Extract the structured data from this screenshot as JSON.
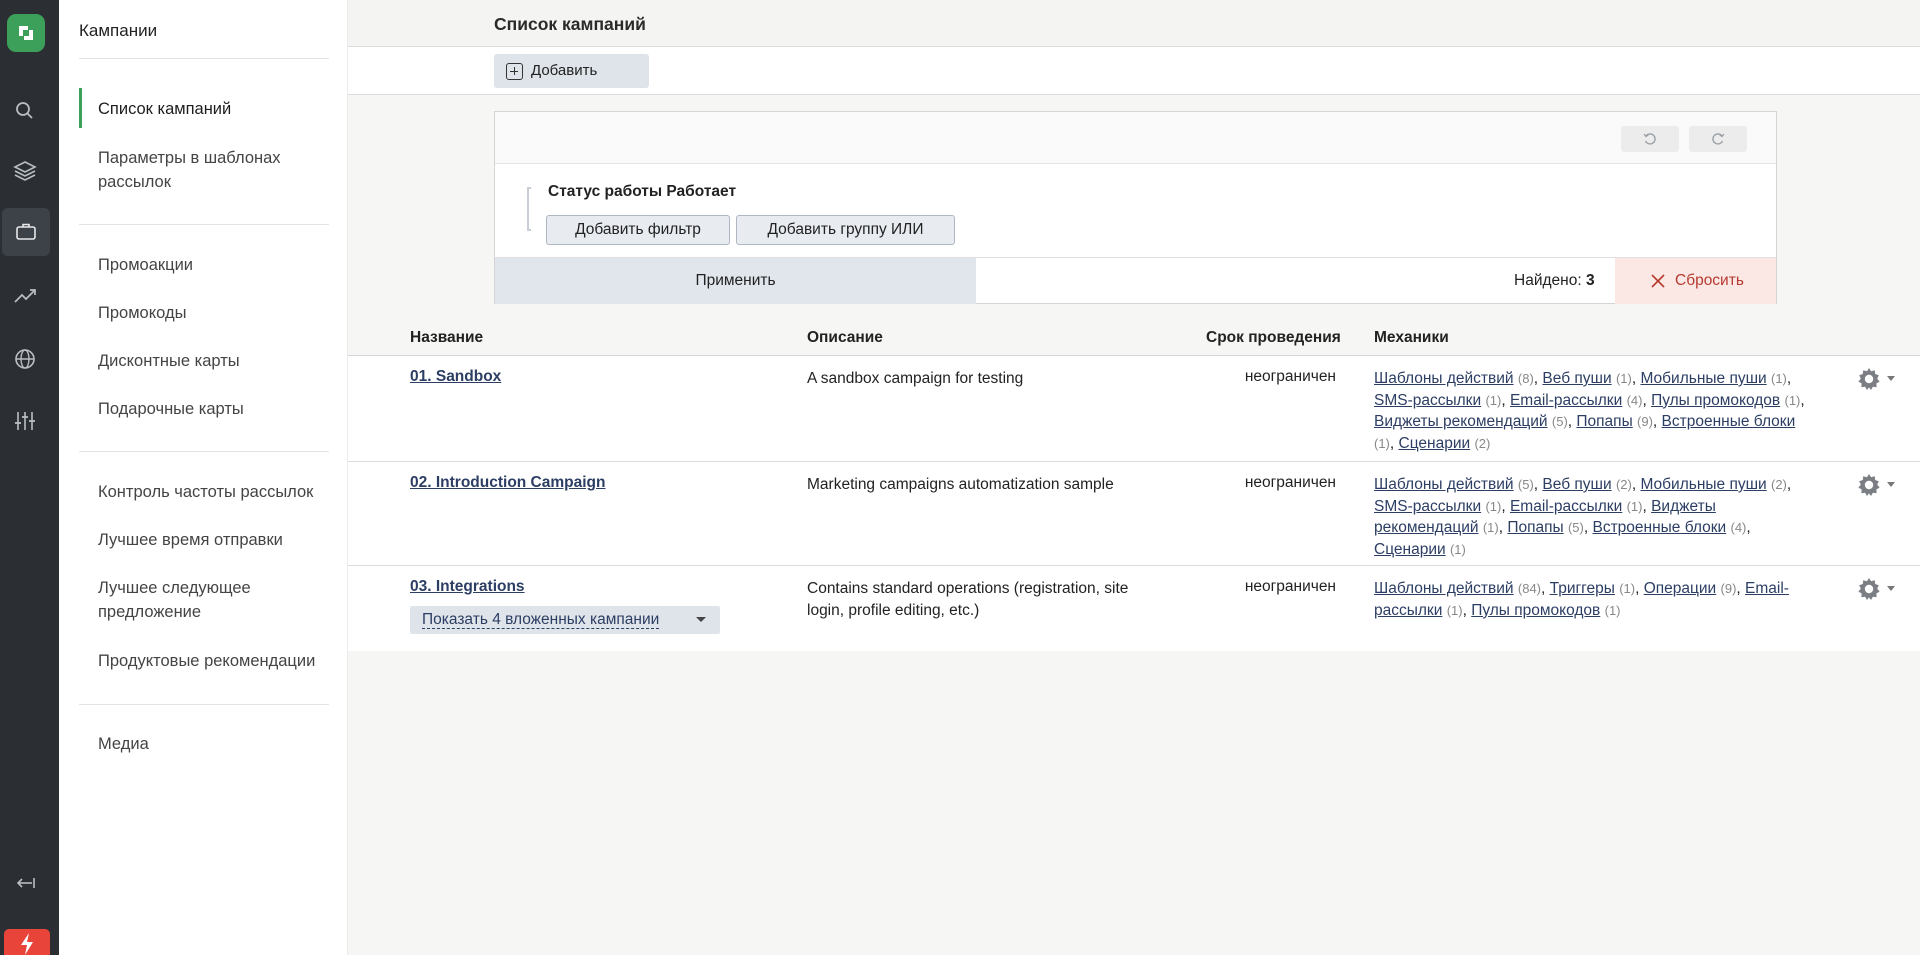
{
  "rail": {
    "icons": [
      "logo-icon",
      "search-icon",
      "layers-icon",
      "briefcase-icon",
      "trend-icon",
      "globe-icon",
      "sliders-icon",
      "collapse-icon",
      "bolt-icon"
    ],
    "accent": "#3da05a"
  },
  "sidebar": {
    "section_title": "Кампании",
    "items": [
      {
        "label": "Список кампаний"
      },
      {
        "label": "Параметры в шаблонах рассылок"
      },
      {
        "label": "Промоакции"
      },
      {
        "label": "Промокоды"
      },
      {
        "label": "Дисконтные карты"
      },
      {
        "label": "Подарочные карты"
      },
      {
        "label": "Контроль частоты рассылок"
      },
      {
        "label": "Лучшее время отправки"
      },
      {
        "label": "Лучшее следующее предложение"
      },
      {
        "label": "Продуктовые рекомендации"
      },
      {
        "label": "Медиа"
      }
    ]
  },
  "header": {
    "title": "Список кампаний",
    "add_label": "Добавить"
  },
  "filter": {
    "status_text": "Статус работы Работает",
    "add_filter_label": "Добавить фильтр",
    "add_group_label": "Добавить группу ИЛИ",
    "apply_label": "Применить",
    "found_label": "Найдено:",
    "found_count": "3",
    "reset_label": "Сбросить"
  },
  "table": {
    "columns": [
      "Название",
      "Описание",
      "Срок проведения",
      "Механики"
    ],
    "rows": [
      {
        "name": "01. Sandbox",
        "description": "A sandbox campaign for testing",
        "duration": "неограничен",
        "mechanics": [
          {
            "label": "Шаблоны действий",
            "count": "(8)"
          },
          {
            "label": "Веб пуши",
            "count": "(1)"
          },
          {
            "label": "Мобильные пуши",
            "count": "(1)"
          },
          {
            "label": "SMS-рассылки",
            "count": "(1)"
          },
          {
            "label": "Email-рассылки",
            "count": "(4)"
          },
          {
            "label": "Пулы промокодов",
            "count": "(1)"
          },
          {
            "label": "Виджеты рекомендаций",
            "count": "(5)"
          },
          {
            "label": "Попапы",
            "count": "(9)"
          },
          {
            "label": "Встроенные блоки",
            "count": "(1)"
          },
          {
            "label": "Сценарии",
            "count": "(2)"
          }
        ]
      },
      {
        "name": "02. Introduction Campaign",
        "description": "Marketing campaigns automatization sample",
        "duration": "неограничен",
        "mechanics": [
          {
            "label": "Шаблоны действий",
            "count": "(5)"
          },
          {
            "label": "Веб пуши",
            "count": "(2)"
          },
          {
            "label": "Мобильные пуши",
            "count": "(2)"
          },
          {
            "label": "SMS-рассылки",
            "count": "(1)"
          },
          {
            "label": "Email-рассылки",
            "count": "(1)"
          },
          {
            "label": "Виджеты рекомендаций",
            "count": "(1)"
          },
          {
            "label": "Попапы",
            "count": "(5)"
          },
          {
            "label": "Встроенные блоки",
            "count": "(4)"
          },
          {
            "label": "Сценарии",
            "count": "(1)"
          }
        ]
      },
      {
        "name": "03. Integrations",
        "description": "Contains standard operations (registration, site login, profile editing, etc.)",
        "duration": "неограничен",
        "nested_label": "Показать 4 вложенных кампании",
        "mechanics": [
          {
            "label": "Шаблоны действий",
            "count": "(84)"
          },
          {
            "label": "Триггеры",
            "count": "(1)"
          },
          {
            "label": "Операции",
            "count": "(9)"
          },
          {
            "label": "Email-рассылки",
            "count": "(1)"
          },
          {
            "label": "Пулы промокодов",
            "count": "(1)"
          }
        ]
      }
    ]
  }
}
